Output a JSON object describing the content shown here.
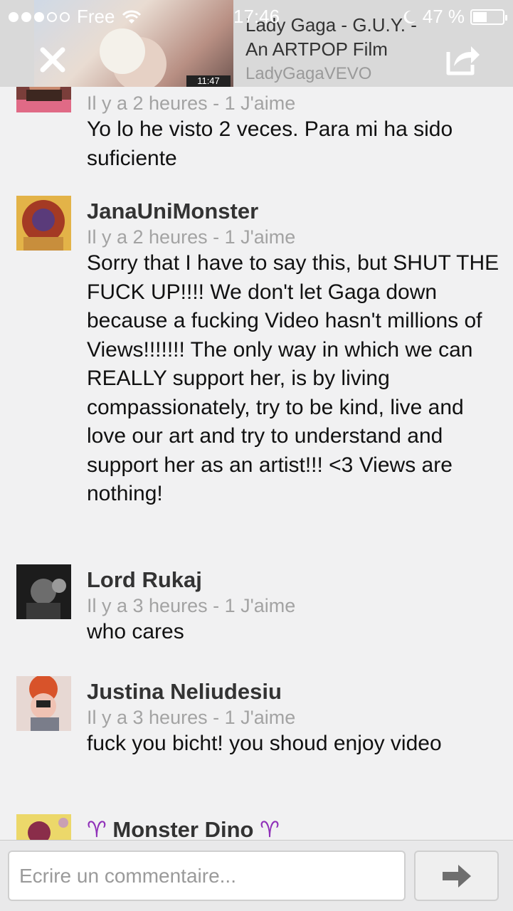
{
  "status_bar": {
    "carrier": "Free",
    "time": "17:46",
    "battery_text": "47 %",
    "battery_level": 0.47,
    "signal_bars_filled": 3,
    "signal_bars_total": 5
  },
  "video": {
    "title": "Lady Gaga - G.U.Y. - An ARTPOP Film",
    "channel": "LadyGagaVEVO",
    "duration": "11:47"
  },
  "comments": [
    {
      "name": "",
      "meta": "Il y a 2 heures - 1 J'aime",
      "text": "Yo lo he visto 2 veces. Para mi ha sido suficiente"
    },
    {
      "name": "JanaUniMonster",
      "meta": "Il y a 2 heures - 1 J'aime",
      "text": "Sorry that I have to say this, but SHUT THE FUCK UP!!!! We don't let Gaga down because a fucking Video hasn't millions of Views!!!!!!! The only way in which we can REALLY support her, is by living compassionately, try to be kind, live and love our art and try to understand and support her as an artist!!! <3 Views are nothing!"
    },
    {
      "name": "Lord Rukaj",
      "meta": "Il y a 3 heures - 1 J'aime",
      "text": "who cares"
    },
    {
      "name": "Justina Neliudesiu",
      "meta": "Il y a 3 heures - 1 J'aime",
      "text": "fuck you bicht! you shoud enjoy video"
    },
    {
      "name": "♈ Monster Dino ♈",
      "meta": "",
      "text": ""
    }
  ],
  "compose": {
    "placeholder": "Ecrire un commentaire..."
  },
  "colors": {
    "background": "#f1f1f2",
    "meta_text": "#a3a3a3",
    "aries_purple": "#8f2fb8"
  }
}
